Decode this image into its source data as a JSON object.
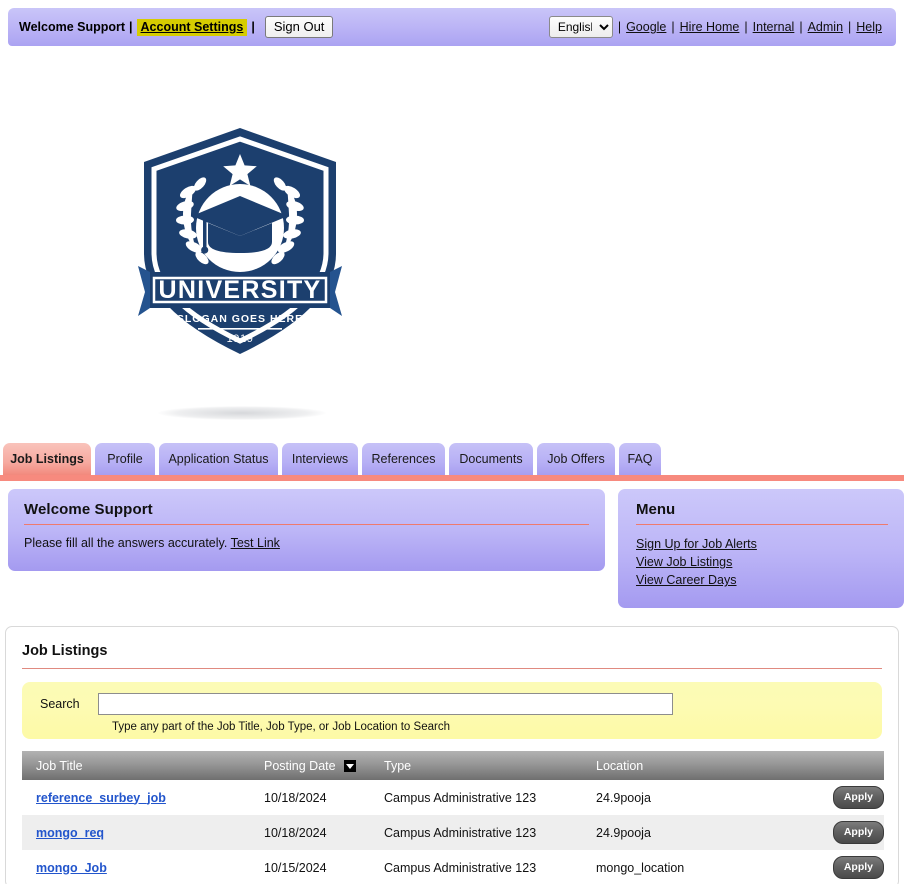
{
  "topbar": {
    "welcome_text": "Welcome Support",
    "separator": "|",
    "account_settings_label": "Account Settings",
    "sign_out_label": "Sign Out",
    "language_selected": "English",
    "language_options": [
      "English"
    ],
    "links": [
      {
        "label": "Google"
      },
      {
        "label": "Hire Home"
      },
      {
        "label": "Internal"
      },
      {
        "label": "Admin"
      },
      {
        "label": "Help"
      }
    ]
  },
  "logo": {
    "name": "university-crest-logo",
    "org_name": "UNIVERSITY",
    "slogan": "SLOGAN GOES HERE",
    "year": "1919",
    "color": "#1c3f6e"
  },
  "tabs": [
    {
      "label": "Job Listings",
      "active": true
    },
    {
      "label": "Profile",
      "active": false
    },
    {
      "label": "Application Status",
      "active": false
    },
    {
      "label": "Interviews",
      "active": false
    },
    {
      "label": "References",
      "active": false
    },
    {
      "label": "Documents",
      "active": false
    },
    {
      "label": "Job Offers",
      "active": false
    },
    {
      "label": "FAQ",
      "active": false
    }
  ],
  "welcome_panel": {
    "title": "Welcome Support",
    "body_text": "Please fill all the answers accurately.",
    "link_label": "Test Link"
  },
  "menu_panel": {
    "title": "Menu",
    "links": [
      {
        "label": "Sign Up for Job Alerts"
      },
      {
        "label": "View Job Listings"
      },
      {
        "label": "View Career Days"
      }
    ]
  },
  "job_listings": {
    "title": "Job Listings",
    "search": {
      "label": "Search",
      "value": "",
      "placeholder": "",
      "hint": "Type any part of the Job Title, Job Type, or Job Location to Search"
    },
    "columns": [
      {
        "label": "Job Title",
        "sorted": false
      },
      {
        "label": "Posting Date",
        "sorted": true
      },
      {
        "label": "Type",
        "sorted": false
      },
      {
        "label": "Location",
        "sorted": false
      },
      {
        "label": "",
        "sorted": false
      }
    ],
    "apply_label": "Apply",
    "rows": [
      {
        "title": "reference_surbey_job",
        "posting_date": "10/18/2024",
        "type": "Campus Administrative 123",
        "location": "24.9pooja",
        "action": "Apply"
      },
      {
        "title": "mongo_req",
        "posting_date": "10/18/2024",
        "type": "Campus Administrative 123",
        "location": "24.9pooja",
        "action": "Apply"
      },
      {
        "title": "mongo_Job",
        "posting_date": "10/15/2024",
        "type": "Campus Administrative 123",
        "location": "mongo_location",
        "action": "Apply"
      }
    ]
  },
  "colors": {
    "topbar_purple": "#b7b0f5",
    "tab_active_salmon": "#f2897d",
    "accent_rule": "#f78a7e",
    "search_yellow": "#fdfaa6",
    "link_blue": "#2255cc",
    "highlight_yellow": "#d6cc00"
  }
}
